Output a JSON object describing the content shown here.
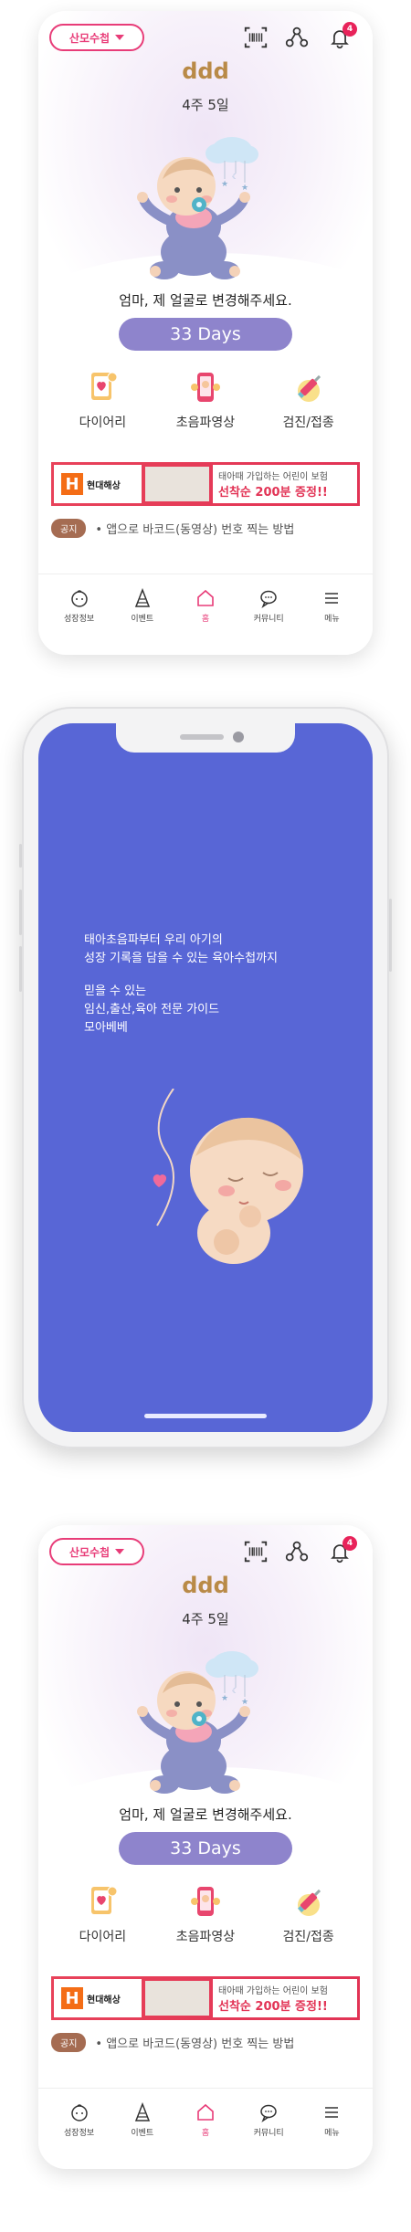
{
  "screens": [
    {
      "mode_label": "산모수첩",
      "notification_count": "4",
      "baby_name": "ddd",
      "pregnancy_week": "4주 5일",
      "message": "엄마, 제 얼굴로 변경해주세요.",
      "days_label": "33 Days",
      "menu": [
        {
          "label": "다이어리",
          "icon": "diary-icon"
        },
        {
          "label": "초음파영상",
          "icon": "ultrasound-icon"
        },
        {
          "label": "검진/접종",
          "icon": "vaccine-icon"
        }
      ],
      "banner": {
        "brand": "현대해상",
        "line1": "태아때 가입하는 어린이 보험",
        "line2": "선착순 200분 증정!!"
      },
      "notice": {
        "tag": "공지",
        "text": "• 앱으로 바코드(동영상) 번호 찍는 방법"
      },
      "nav": [
        {
          "label": "성장정보",
          "icon": "baby-face-icon"
        },
        {
          "label": "이벤트",
          "icon": "party-hat-icon"
        },
        {
          "label": "홈",
          "icon": "home-icon"
        },
        {
          "label": "커뮤니티",
          "icon": "chat-icon"
        },
        {
          "label": "메뉴",
          "icon": "hamburger-icon"
        }
      ]
    },
    {
      "mode_label": "산모수첩",
      "notification_count": "4",
      "baby_name": "ddd",
      "pregnancy_week": "4주 5일",
      "message": "엄마, 제 얼굴로 변경해주세요.",
      "days_label": "33 Days",
      "menu": [
        {
          "label": "다이어리",
          "icon": "diary-icon"
        },
        {
          "label": "초음파영상",
          "icon": "ultrasound-icon"
        },
        {
          "label": "검진/접종",
          "icon": "vaccine-icon"
        }
      ],
      "banner": {
        "brand": "현대해상",
        "line1": "태아때 가입하는 어린이 보험",
        "line2": "선착순 200분 증정!!"
      },
      "notice": {
        "tag": "공지",
        "text": "• 앱으로 바코드(동영상) 번호 찍는 방법"
      },
      "nav": [
        {
          "label": "성장정보",
          "icon": "baby-face-icon"
        },
        {
          "label": "이벤트",
          "icon": "party-hat-icon"
        },
        {
          "label": "홈",
          "icon": "home-icon"
        },
        {
          "label": "커뮤니티",
          "icon": "chat-icon"
        },
        {
          "label": "메뉴",
          "icon": "hamburger-icon"
        }
      ]
    }
  ],
  "splash": {
    "lines": [
      "태아초음파부터 우리 아기의",
      "성장 기록을 담을 수 있는 육아수첩까지"
    ],
    "lines2": [
      "믿을 수 있는",
      "임신,출산,육아 전문 가이드",
      "모아베베"
    ]
  },
  "colors": {
    "accent": "#e83c78",
    "days_pill": "#8e84cc",
    "splash_bg": "#5866d6",
    "name": "#b98a47",
    "notice_tag": "#a56c52"
  }
}
